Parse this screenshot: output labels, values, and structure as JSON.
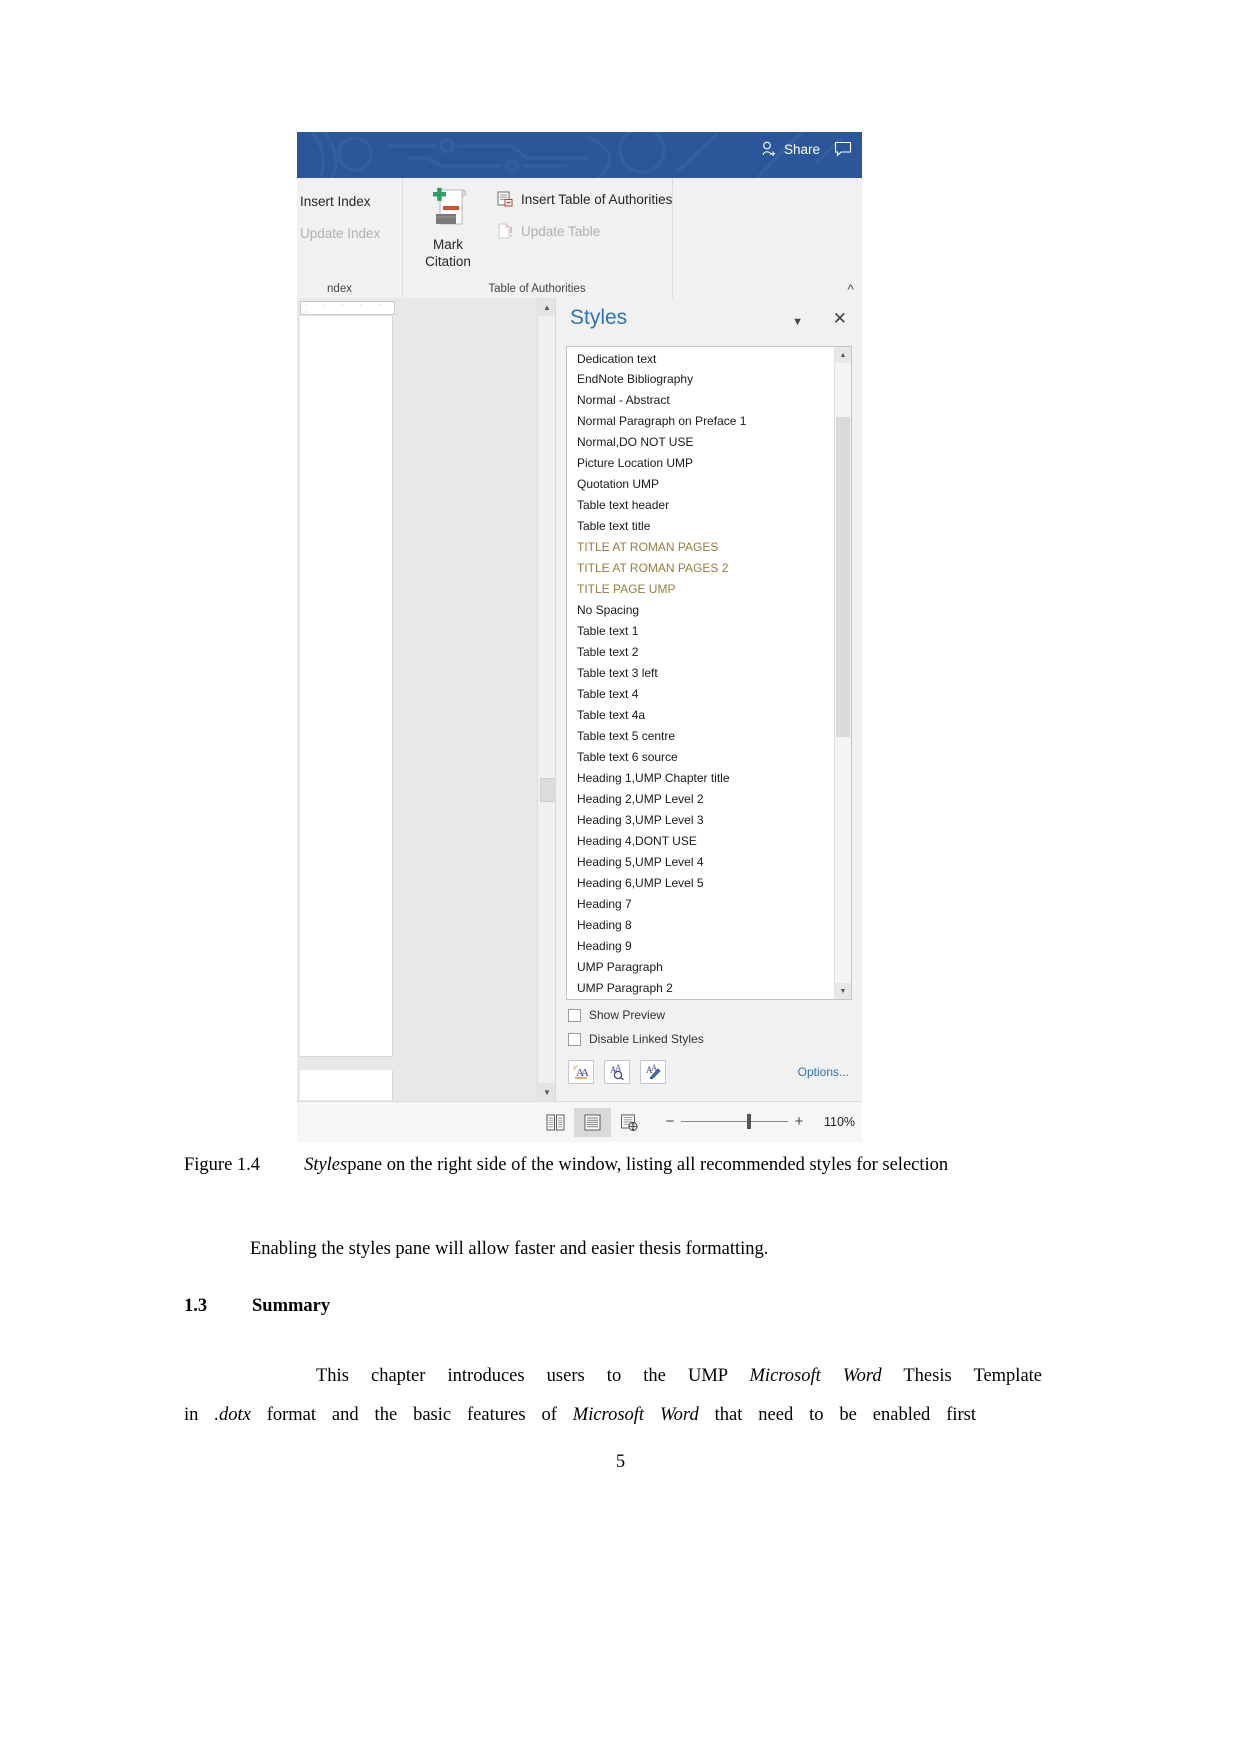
{
  "screenshot": {
    "titlebar": {
      "share_label": "Share",
      "share_icon": "person-add-icon",
      "comment_icon": "comment-icon",
      "background_color": "#2b579a"
    },
    "ribbon": {
      "groups": [
        {
          "name": "index",
          "label": "ndex",
          "buttons": [
            {
              "label": "Insert Index",
              "enabled": true
            },
            {
              "label": "Update Index",
              "enabled": false
            }
          ]
        },
        {
          "name": "table-of-authorities",
          "label": "Table of Authorities",
          "mark_citation_label": "Mark\nCitation",
          "mark_citation_line1": "Mark",
          "mark_citation_line2": "Citation",
          "buttons": [
            {
              "label": "Insert Table of Authorities",
              "enabled": true
            },
            {
              "label": "Update Table",
              "enabled": false
            }
          ]
        }
      ],
      "collapse_icon": "chevron-up-icon"
    },
    "styles_pane": {
      "title": "Styles",
      "chevron_icon": "chevron-down-icon",
      "close_icon": "close-icon",
      "items": [
        {
          "name": "Dedication text",
          "mark": "¶",
          "mark_type": "paragraph",
          "tan": false
        },
        {
          "name": "EndNote Bibliography",
          "mark": "¶a",
          "mark_type": "linked",
          "tan": false
        },
        {
          "name": "Normal - Abstract",
          "mark": "¶",
          "mark_type": "paragraph",
          "tan": false
        },
        {
          "name": "Normal Paragraph on Preface 1",
          "mark": "¶",
          "mark_type": "paragraph",
          "tan": false
        },
        {
          "name": "Normal,DO NOT USE",
          "mark": "¶",
          "mark_type": "paragraph",
          "tan": false
        },
        {
          "name": "Picture Location UMP",
          "mark": "¶",
          "mark_type": "paragraph",
          "tan": false
        },
        {
          "name": "Quotation UMP",
          "mark": "¶",
          "mark_type": "paragraph",
          "tan": false
        },
        {
          "name": "Table text header",
          "mark": "¶",
          "mark_type": "paragraph",
          "tan": false
        },
        {
          "name": "Table text title",
          "mark": "¶",
          "mark_type": "paragraph",
          "tan": false
        },
        {
          "name": "TITLE AT ROMAN PAGES",
          "mark": "¶",
          "mark_type": "paragraph",
          "tan": true
        },
        {
          "name": "TITLE AT ROMAN PAGES 2",
          "mark": "¶",
          "mark_type": "paragraph",
          "tan": true
        },
        {
          "name": "TITLE PAGE UMP",
          "mark": "¶",
          "mark_type": "paragraph",
          "tan": true
        },
        {
          "name": "No Spacing",
          "mark": "¶a",
          "mark_type": "linked",
          "tan": false
        },
        {
          "name": "Table text 1",
          "mark": "¶a",
          "mark_type": "linked",
          "tan": false
        },
        {
          "name": "Table text 2",
          "mark": "¶a",
          "mark_type": "linked",
          "tan": false
        },
        {
          "name": "Table text 3 left",
          "mark": "¶a",
          "mark_type": "linked",
          "tan": false
        },
        {
          "name": "Table text 4",
          "mark": "¶a",
          "mark_type": "linked",
          "tan": false
        },
        {
          "name": "Table text 4a",
          "mark": "¶",
          "mark_type": "paragraph",
          "tan": false
        },
        {
          "name": "Table text 5 centre",
          "mark": "¶",
          "mark_type": "paragraph",
          "tan": false
        },
        {
          "name": "Table text 6 source",
          "mark": "¶",
          "mark_type": "paragraph",
          "tan": false
        },
        {
          "name": "Heading 1,UMP Chapter title",
          "mark": "¶a",
          "mark_type": "linked",
          "tan": false
        },
        {
          "name": "Heading 2,UMP Level 2",
          "mark": "¶a",
          "mark_type": "linked",
          "tan": false
        },
        {
          "name": "Heading 3,UMP Level 3",
          "mark": "¶a",
          "mark_type": "linked",
          "tan": false
        },
        {
          "name": "Heading 4,DONT USE",
          "mark": "¶a",
          "mark_type": "linked",
          "tan": false
        },
        {
          "name": "Heading 5,UMP Level 4",
          "mark": "¶a",
          "mark_type": "linked",
          "tan": false
        },
        {
          "name": "Heading 6,UMP Level 5",
          "mark": "¶a",
          "mark_type": "linked",
          "tan": false
        },
        {
          "name": "Heading 7",
          "mark": "¶a",
          "mark_type": "linked",
          "tan": false
        },
        {
          "name": "Heading 8",
          "mark": "¶a",
          "mark_type": "linked",
          "tan": false
        },
        {
          "name": "Heading 9",
          "mark": "¶a",
          "mark_type": "linked",
          "tan": false
        },
        {
          "name": "UMP Paragraph",
          "mark": "¶a",
          "mark_type": "linked",
          "tan": false
        },
        {
          "name": "UMP Paragraph 2",
          "mark": "¶",
          "mark_type": "paragraph",
          "tan": false
        }
      ],
      "show_preview_label": "Show Preview",
      "show_preview_checked": false,
      "disable_linked_label": "Disable Linked Styles",
      "disable_linked_checked": false,
      "tools": [
        {
          "icon": "new-style-icon"
        },
        {
          "icon": "style-inspector-icon"
        },
        {
          "icon": "manage-styles-icon"
        }
      ],
      "options_label": "Options...",
      "options_color": "#2e74b5"
    },
    "statusbar": {
      "views": [
        {
          "icon": "read-mode-icon",
          "active": false
        },
        {
          "icon": "print-layout-icon",
          "active": true
        },
        {
          "icon": "web-layout-icon",
          "active": false
        }
      ],
      "zoom_out_label": "−",
      "zoom_in_label": "+",
      "zoom_value": "110%"
    }
  },
  "paper": {
    "caption": {
      "figure_label": "Figure 1.4",
      "italic_word": "Styles",
      "rest": "pane on the right side of the window, listing all recommended styles for selection"
    },
    "paragraph_1": "Enabling the styles pane will allow faster and easier thesis formatting.",
    "section": {
      "number": "1.3",
      "title": "Summary"
    },
    "paragraph_2": {
      "line1_a": "This chapter introduces users to the UMP ",
      "line1_i": "Microsoft Word",
      "line1_b": " Thesis Template",
      "line2_a": "in ",
      "line2_i1": ".dotx",
      "line2_b": " format and the basic features of ",
      "line2_i2": "Microsoft Word",
      "line2_c": " that need to be enabled first"
    },
    "page_number": "5"
  }
}
